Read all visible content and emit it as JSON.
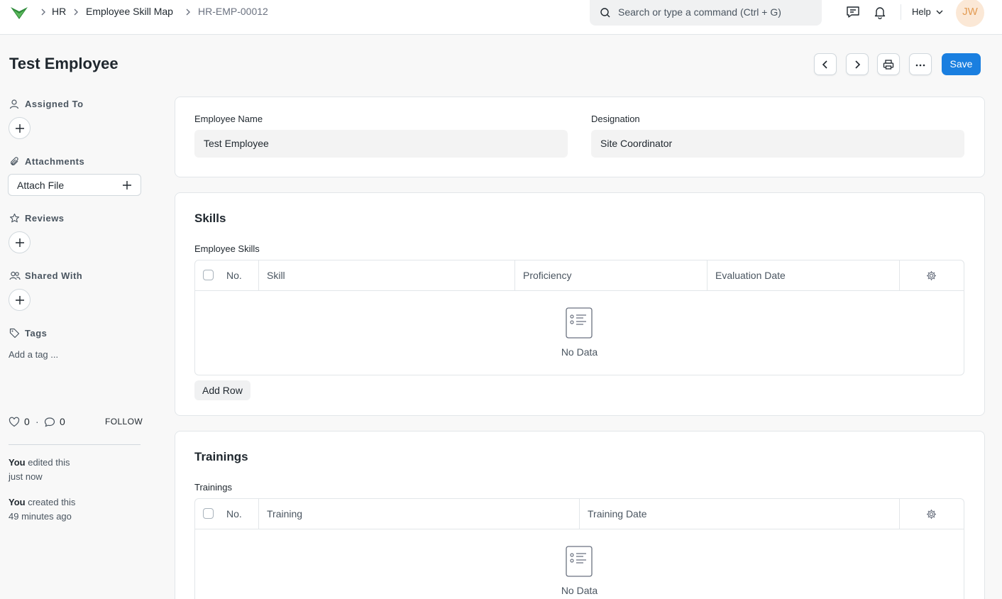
{
  "navbar": {
    "breadcrumbs": [
      "HR",
      "Employee Skill Map",
      "HR-EMP-00012"
    ],
    "search_placeholder": "Search or type a command (Ctrl + G)",
    "help_label": "Help",
    "avatar_initials": "JW",
    "logo_color": "#2e8b3a"
  },
  "page": {
    "title": "Test Employee",
    "save_label": "Save",
    "primary_color": "#1a7fe0"
  },
  "sidebar": {
    "assigned_to": "Assigned To",
    "attachments": "Attachments",
    "attach_file": "Attach File",
    "reviews": "Reviews",
    "shared_with": "Shared With",
    "tags": "Tags",
    "tag_placeholder": "Add a tag ...",
    "likes": "0",
    "comments": "0",
    "dot": "·",
    "follow": "FOLLOW",
    "activity": [
      {
        "who": "You",
        "what": "edited this",
        "when": "just now"
      },
      {
        "who": "You",
        "what": "created this",
        "when": "49 minutes ago"
      }
    ]
  },
  "details": {
    "employee_name_label": "Employee Name",
    "employee_name_value": "Test Employee",
    "designation_label": "Designation",
    "designation_value": "Site Coordinator"
  },
  "skills": {
    "section_title": "Skills",
    "table_label": "Employee Skills",
    "columns": [
      "No.",
      "Skill",
      "Proficiency",
      "Evaluation Date"
    ],
    "empty_text": "No Data",
    "add_row": "Add Row"
  },
  "trainings": {
    "section_title": "Trainings",
    "table_label": "Trainings",
    "columns": [
      "No.",
      "Training",
      "Training Date"
    ],
    "empty_text": "No Data"
  }
}
